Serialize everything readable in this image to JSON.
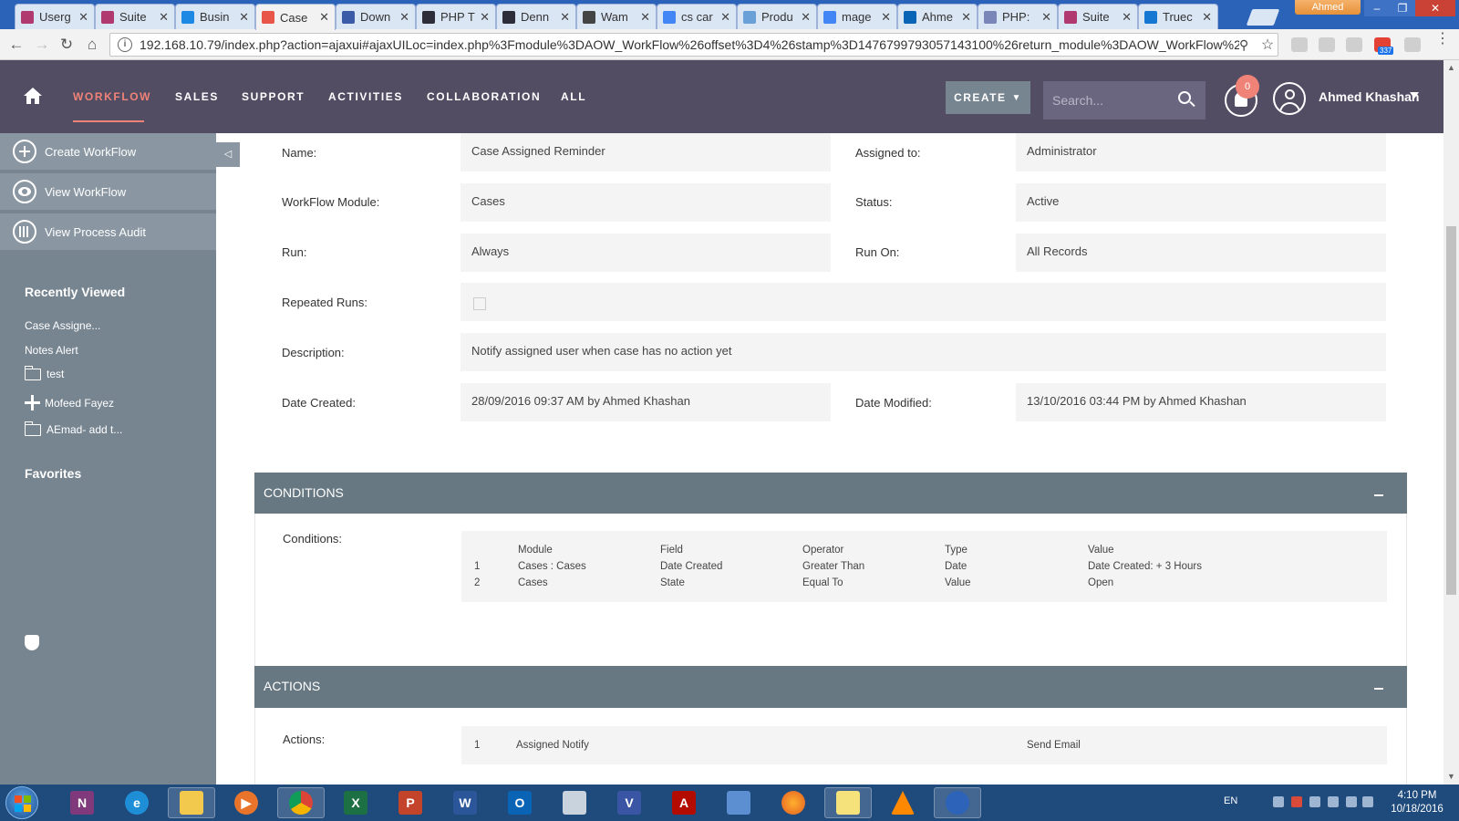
{
  "browser": {
    "tabs": [
      {
        "title": "Userg",
        "color": "#b03a6f"
      },
      {
        "title": "Suite",
        "color": "#b03a6f"
      },
      {
        "title": "Busin",
        "color": "#1e88e5"
      },
      {
        "title": "Case",
        "color": "#e8564a"
      },
      {
        "title": "Down",
        "color": "#3b5ba9"
      },
      {
        "title": "PHP T",
        "color": "#2d2d3a"
      },
      {
        "title": "Denn",
        "color": "#2d2d3a"
      },
      {
        "title": "Wam",
        "color": "#444444"
      },
      {
        "title": "cs car",
        "color": "#4285f4"
      },
      {
        "title": "Produ",
        "color": "#6aa0d8"
      },
      {
        "title": "mage",
        "color": "#4285f4"
      },
      {
        "title": "Ahme",
        "color": "#0a64b5"
      },
      {
        "title": "PHP:",
        "color": "#7a86b8"
      },
      {
        "title": "Suite",
        "color": "#b03a6f"
      },
      {
        "title": "Truec",
        "color": "#1677d2"
      }
    ],
    "profile_name": "Ahmed",
    "url": "192.168.10.79/index.php?action=ajaxui#ajaxUILoc=index.php%3Fmodule%3DAOW_WorkFlow%26offset%3D4%26stamp%3D1476799793057143100%26return_module%3DAOW_WorkFlow%26act",
    "gmail_count": "337"
  },
  "nav": {
    "items": [
      "WORKFLOW",
      "SALES",
      "SUPPORT",
      "ACTIVITIES",
      "COLLABORATION",
      "ALL"
    ],
    "create_label": "CREATE",
    "search_placeholder": "Search...",
    "notification_count": "0",
    "user_name": "Ahmed Khashan"
  },
  "sidebar": {
    "actions": [
      "Create WorkFlow",
      "View WorkFlow",
      "View Process Audit"
    ],
    "recently_viewed_heading": "Recently Viewed",
    "recent": [
      "Case Assigne...",
      "Notes Alert",
      "test",
      "Mofeed Fayez",
      "AEmad- add t..."
    ],
    "favorites_heading": "Favorites"
  },
  "detail": {
    "name_label": "Name:",
    "name_value": "Case Assigned Reminder",
    "assigned_label": "Assigned to:",
    "assigned_value": "Administrator",
    "module_label": "WorkFlow Module:",
    "module_value": "Cases",
    "status_label": "Status:",
    "status_value": "Active",
    "run_label": "Run:",
    "run_value": "Always",
    "run_on_label": "Run On:",
    "run_on_value": "All Records",
    "repeated_label": "Repeated Runs:",
    "description_label": "Description:",
    "description_value": "Notify assigned user when case has no action yet",
    "created_label": "Date Created:",
    "created_value": "28/09/2016 09:37 AM by Ahmed Khashan",
    "modified_label": "Date Modified:",
    "modified_value": "13/10/2016 03:44 PM by Ahmed Khashan"
  },
  "conditions": {
    "heading": "CONDITIONS",
    "label": "Conditions:",
    "columns": [
      "Module",
      "Field",
      "Operator",
      "Type",
      "Value"
    ],
    "rows": [
      {
        "num": "1",
        "module": "Cases : Cases",
        "field": "Date Created",
        "operator": "Greater Than",
        "type": "Date",
        "value": "Date Created: + 3 Hours"
      },
      {
        "num": "2",
        "module": "Cases",
        "field": "State",
        "operator": "Equal To",
        "type": "Value",
        "value": "Open"
      }
    ]
  },
  "actions": {
    "heading": "ACTIONS",
    "label": "Actions:",
    "rows": [
      {
        "num": "1",
        "name": "Assigned Notify",
        "action": "Send Email"
      }
    ]
  },
  "taskbar": {
    "lang": "EN",
    "time": "4:10 PM",
    "date": "10/18/2016"
  },
  "colors": {
    "header_bg": "#534d64",
    "accent": "#f08377",
    "sidebar_bg": "#778591",
    "panel_header": "#677882"
  }
}
